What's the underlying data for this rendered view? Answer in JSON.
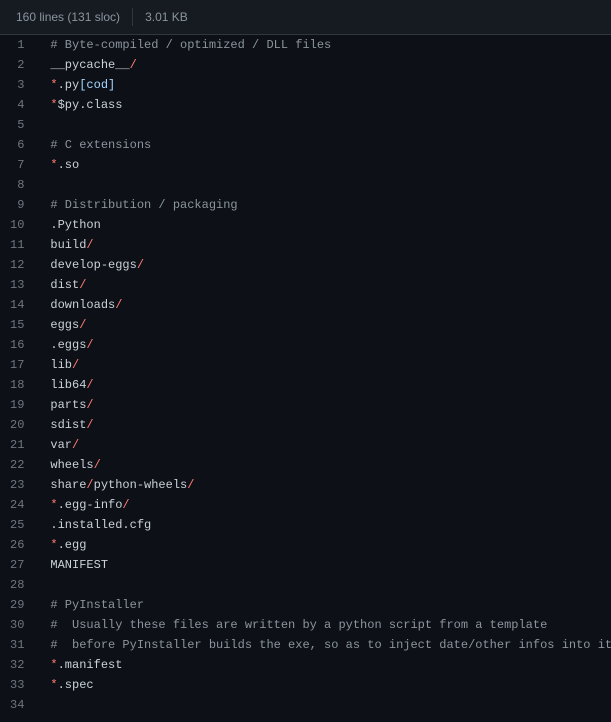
{
  "header": {
    "lines_sloc": "160 lines (131 sloc)",
    "size": "3.01 KB"
  },
  "code": {
    "start_line": 1,
    "rows": [
      [
        {
          "t": "# Byte-compiled / optimized / DLL files",
          "c": "pl-c"
        }
      ],
      [
        {
          "t": "__pycache__",
          "c": "pl-e"
        },
        {
          "t": "/",
          "c": "pl-k"
        }
      ],
      [
        {
          "t": "*",
          "c": "pl-k"
        },
        {
          "t": ".py",
          "c": "pl-e"
        },
        {
          "t": "[cod]",
          "c": "pl-s"
        }
      ],
      [
        {
          "t": "*",
          "c": "pl-k"
        },
        {
          "t": "$py.class",
          "c": "pl-e"
        }
      ],
      [],
      [
        {
          "t": "# C extensions",
          "c": "pl-c"
        }
      ],
      [
        {
          "t": "*",
          "c": "pl-k"
        },
        {
          "t": ".so",
          "c": "pl-e"
        }
      ],
      [],
      [
        {
          "t": "# Distribution / packaging",
          "c": "pl-c"
        }
      ],
      [
        {
          "t": ".Python",
          "c": "pl-e"
        }
      ],
      [
        {
          "t": "build",
          "c": "pl-e"
        },
        {
          "t": "/",
          "c": "pl-k"
        }
      ],
      [
        {
          "t": "develop-eggs",
          "c": "pl-e"
        },
        {
          "t": "/",
          "c": "pl-k"
        }
      ],
      [
        {
          "t": "dist",
          "c": "pl-e"
        },
        {
          "t": "/",
          "c": "pl-k"
        }
      ],
      [
        {
          "t": "downloads",
          "c": "pl-e"
        },
        {
          "t": "/",
          "c": "pl-k"
        }
      ],
      [
        {
          "t": "eggs",
          "c": "pl-e"
        },
        {
          "t": "/",
          "c": "pl-k"
        }
      ],
      [
        {
          "t": ".eggs",
          "c": "pl-e"
        },
        {
          "t": "/",
          "c": "pl-k"
        }
      ],
      [
        {
          "t": "lib",
          "c": "pl-e"
        },
        {
          "t": "/",
          "c": "pl-k"
        }
      ],
      [
        {
          "t": "lib64",
          "c": "pl-e"
        },
        {
          "t": "/",
          "c": "pl-k"
        }
      ],
      [
        {
          "t": "parts",
          "c": "pl-e"
        },
        {
          "t": "/",
          "c": "pl-k"
        }
      ],
      [
        {
          "t": "sdist",
          "c": "pl-e"
        },
        {
          "t": "/",
          "c": "pl-k"
        }
      ],
      [
        {
          "t": "var",
          "c": "pl-e"
        },
        {
          "t": "/",
          "c": "pl-k"
        }
      ],
      [
        {
          "t": "wheels",
          "c": "pl-e"
        },
        {
          "t": "/",
          "c": "pl-k"
        }
      ],
      [
        {
          "t": "share",
          "c": "pl-e"
        },
        {
          "t": "/",
          "c": "pl-k"
        },
        {
          "t": "python-wheels",
          "c": "pl-e"
        },
        {
          "t": "/",
          "c": "pl-k"
        }
      ],
      [
        {
          "t": "*",
          "c": "pl-k"
        },
        {
          "t": ".egg-info",
          "c": "pl-e"
        },
        {
          "t": "/",
          "c": "pl-k"
        }
      ],
      [
        {
          "t": ".installed.cfg",
          "c": "pl-e"
        }
      ],
      [
        {
          "t": "*",
          "c": "pl-k"
        },
        {
          "t": ".egg",
          "c": "pl-e"
        }
      ],
      [
        {
          "t": "MANIFEST",
          "c": "pl-e"
        }
      ],
      [],
      [
        {
          "t": "# PyInstaller",
          "c": "pl-c"
        }
      ],
      [
        {
          "t": "#  Usually these files are written by a python script from a template",
          "c": "pl-c"
        }
      ],
      [
        {
          "t": "#  before PyInstaller builds the exe, so as to inject date/other infos into it.",
          "c": "pl-c"
        }
      ],
      [
        {
          "t": "*",
          "c": "pl-k"
        },
        {
          "t": ".manifest",
          "c": "pl-e"
        }
      ],
      [
        {
          "t": "*",
          "c": "pl-k"
        },
        {
          "t": ".spec",
          "c": "pl-e"
        }
      ],
      []
    ]
  }
}
